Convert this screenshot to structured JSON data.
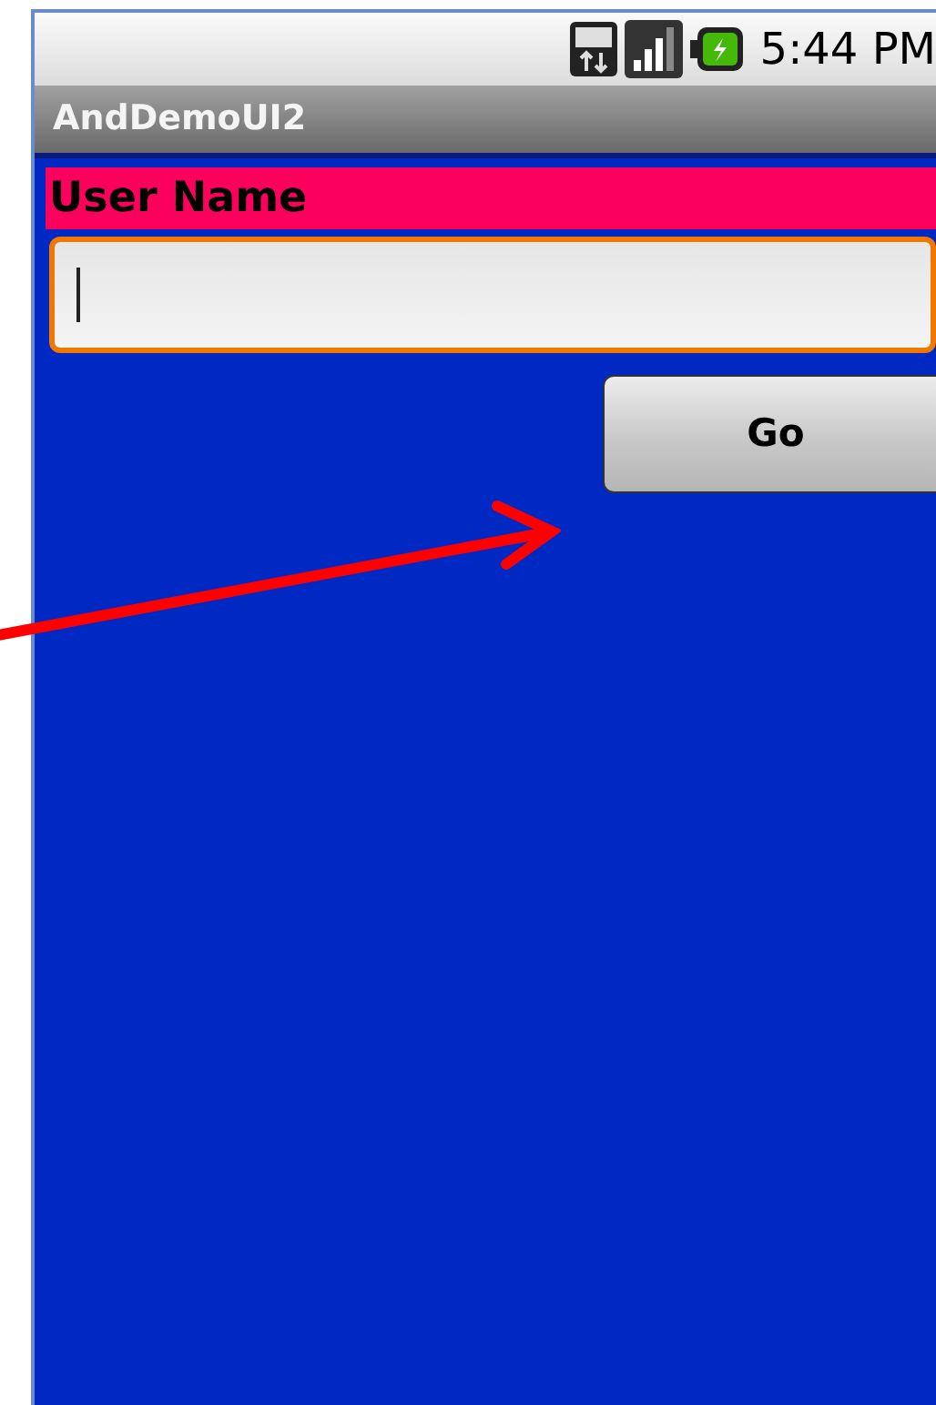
{
  "status_bar": {
    "time": "5:44 PM"
  },
  "window": {
    "title": "AndDemoUI2"
  },
  "form": {
    "label": "User Name",
    "field": {
      "focused": true
    },
    "button": "Go"
  }
}
